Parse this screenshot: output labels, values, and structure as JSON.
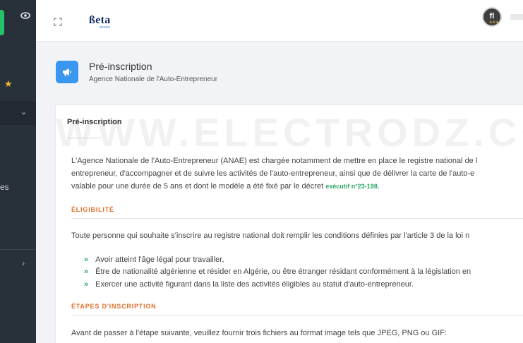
{
  "header": {
    "brand": "ßeta",
    "brand_sub": "version",
    "avatar_initials": "fl",
    "avatar_dots": "★★★"
  },
  "sidebar": {
    "partial_label": "es"
  },
  "page": {
    "title": "Pré-inscription",
    "subtitle": "Agence Nationale de l'Auto-Entrepreneur"
  },
  "card": {
    "title": "Pré-inscription",
    "watermark": "WWW.ELECTRODZ.COM",
    "intro_lines": [
      "L'Agence Nationale de l'Auto-Entrepreneur (ANAE) est chargée notamment de mettre en place le registre national de l",
      "entrepreneur, d'accompagner et de suivre les activités de l'auto-entrepreneur, ainsi que de délivrer la carte de l'auto-e",
      "valable pour une durée de 5 ans et dont le modèle a été fixé par le décret "
    ],
    "decret_link": "exécutif n°23-198",
    "intro_end": ".",
    "eligibility": {
      "title": "ÉLIGIBILITÉ",
      "text": "Toute personne qui souhaite s'inscrire au registre national doit remplir les conditions définies par l'article 3 de la loi n",
      "items": [
        "Avoir atteint l'âge légal pour travailler,",
        "Être de nationalité algérienne et résider en Algérie, ou être étranger résidant conformément à la législation en",
        "Exercer une activité figurant dans la liste des activités éligibles au statut d'auto-entrepreneur."
      ],
      "bullet": "»"
    },
    "steps": {
      "title": "ÉTAPES D'INSCRIPTION",
      "text": "Avant de passer à l'étape suivante, veuillez fournir trois fichiers au format image tels que JPEG, PNG ou GIF:"
    }
  }
}
